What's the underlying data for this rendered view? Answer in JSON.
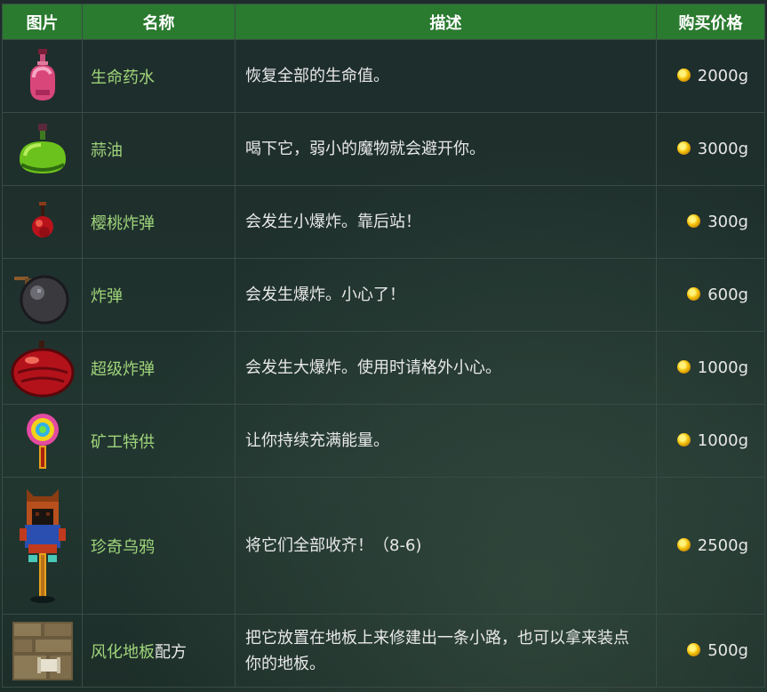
{
  "headers": {
    "image": "图片",
    "name": "名称",
    "description": "描述",
    "price": "购买价格"
  },
  "items": [
    {
      "icon": "life-elixir-icon",
      "name": "生命药水",
      "description": "恢复全部的生命值。",
      "price": "2000g"
    },
    {
      "icon": "oil-of-garlic-icon",
      "name": "蒜油",
      "description": "喝下它，弱小的魔物就会避开你。",
      "price": "3000g"
    },
    {
      "icon": "cherry-bomb-icon",
      "name": "樱桃炸弹",
      "description": "会发生小爆炸。靠后站！",
      "price": "300g"
    },
    {
      "icon": "bomb-icon",
      "name": "炸弹",
      "description": "会发生爆炸。小心了！",
      "price": "600g"
    },
    {
      "icon": "mega-bomb-icon",
      "name": "超级炸弹",
      "description": "会发生大爆炸。使用时请格外小心。",
      "price": "1000g"
    },
    {
      "icon": "miners-treat-icon",
      "name": "矿工特供",
      "description": "让你持续充满能量。",
      "price": "1000g"
    },
    {
      "icon": "rarecrow-icon",
      "name": "珍奇乌鸦",
      "description": "将它们全部收齐！（8-6)",
      "price": "2500g"
    },
    {
      "icon": "weathered-floor-recipe-icon",
      "name": "风化地板",
      "name_suffix": "配方",
      "description": "把它放置在地板上来修建出一条小路，也可以拿来装点你的地板。",
      "price": "500g"
    }
  ],
  "colors": {
    "header_bg": "#2a7a2f",
    "link": "#9fd47a",
    "coin": "#f6c40c"
  }
}
